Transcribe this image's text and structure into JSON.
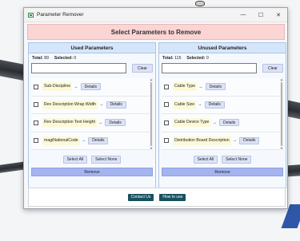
{
  "window": {
    "title": "Parameter Remover",
    "controls": {
      "minimize": "—",
      "maximize": "☐",
      "close": "✕"
    }
  },
  "banner": "Select Parameters to Remove",
  "used": {
    "header": "Used Parameters",
    "total_label": "Total:",
    "total": "89",
    "selected_label": "Selected:",
    "selected": "0",
    "search_value": "",
    "clear_label": "Clear",
    "items": [
      {
        "name": "Sub-Discipline",
        "arrow": "→",
        "details": "Details"
      },
      {
        "name": "Rev Description Wrap Width",
        "arrow": "→",
        "details": "Details"
      },
      {
        "name": "Rev Description Text Height",
        "arrow": "→",
        "details": "Details"
      },
      {
        "name": "magiNationalCode",
        "arrow": "→",
        "details": "Details"
      }
    ],
    "select_all": "Select All",
    "select_none": "Select None",
    "remove": "Remove"
  },
  "unused": {
    "header": "Unused Parameters",
    "total_label": "Total:",
    "total": "115",
    "selected_label": "Selected:",
    "selected": "0",
    "search_value": "",
    "clear_label": "Clear",
    "items": [
      {
        "name": "Cable Type",
        "arrow": "→",
        "details": "Details"
      },
      {
        "name": "Cable Size",
        "arrow": "→",
        "details": "Details"
      },
      {
        "name": "Cable Device Type",
        "arrow": "→",
        "details": "Details"
      },
      {
        "name": "Distribution Board Description",
        "arrow": "→",
        "details": "Details"
      }
    ],
    "select_all": "Select All",
    "select_none": "Select None",
    "remove": "Remove"
  },
  "footer": {
    "contact": "Contact Us",
    "how_to": "How to use"
  },
  "colors": {
    "banner_bg": "#fbd4d4",
    "panel_header_bg": "#d6e6fa",
    "param_name_bg": "#fcf9d8",
    "remove_bg": "#a5b4ef",
    "footer_button_bg": "#17505e"
  }
}
